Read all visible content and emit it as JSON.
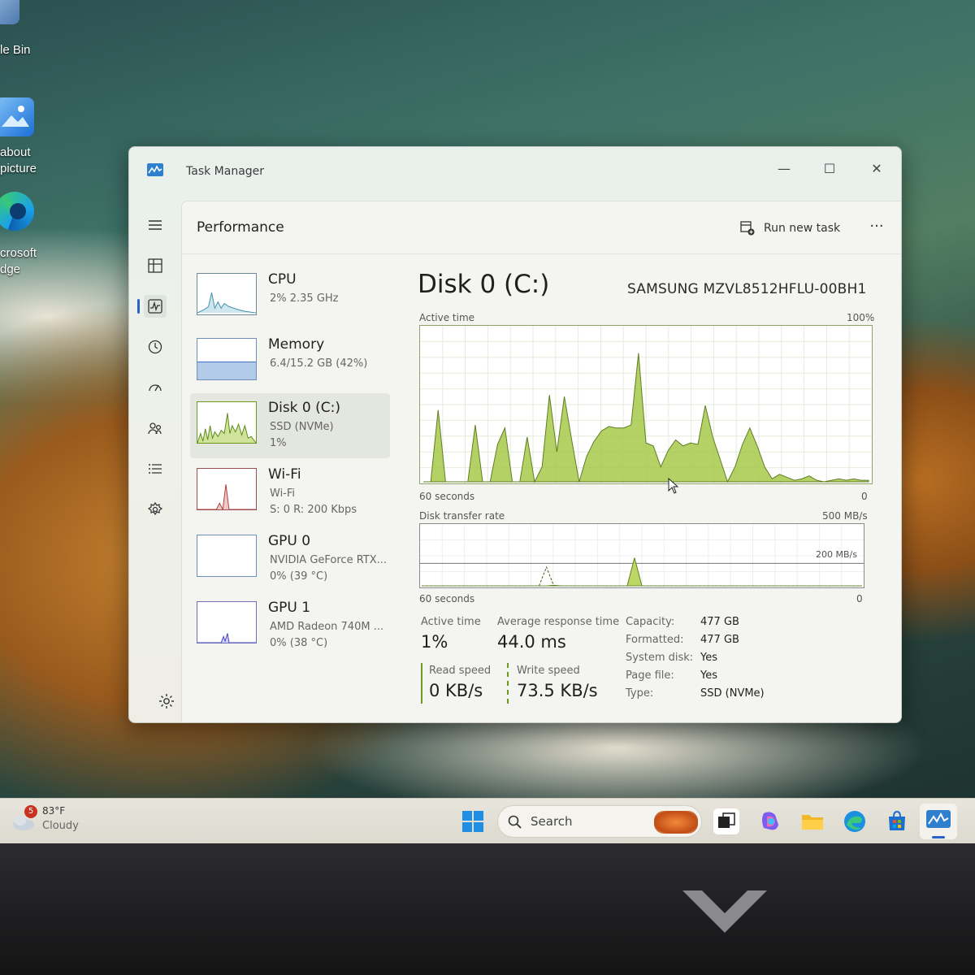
{
  "desktop": {
    "icons": [
      {
        "label_lines": [
          "le Bin"
        ]
      },
      {
        "label_lines": [
          " about",
          "picture"
        ]
      },
      {
        "label_lines": [
          "crosoft",
          "dge"
        ]
      }
    ]
  },
  "window": {
    "title": "Task Manager",
    "minimize_glyph": "—",
    "maximize_glyph": "☐",
    "close_glyph": "✕"
  },
  "header": {
    "page_title": "Performance",
    "run_new_task_label": "Run new task",
    "more_glyph": "···"
  },
  "nav": {
    "items": [
      "hamburger-icon",
      "processes-icon",
      "performance-icon",
      "app-history-icon",
      "startup-apps-icon",
      "users-icon",
      "details-icon",
      "services-icon"
    ],
    "active_index": 2
  },
  "devices": [
    {
      "name": "CPU",
      "sub": "2%  2.35 GHz",
      "sub2": "",
      "color": "#3d8fb0"
    },
    {
      "name": "Memory",
      "sub": "6.4/15.2 GB (42%)",
      "sub2": "",
      "color": "#3f78c8"
    },
    {
      "name": "Disk 0 (C:)",
      "sub": "SSD (NVMe)",
      "sub2": "1%",
      "color": "#6b9a1c"
    },
    {
      "name": "Wi-Fi",
      "sub": "Wi-Fi",
      "sub2": "S: 0  R: 200 Kbps",
      "color": "#b03a3a"
    },
    {
      "name": "GPU 0",
      "sub": "NVIDIA GeForce RTX...",
      "sub2": "0%  (39 °C)",
      "color": "#3f6fb0"
    },
    {
      "name": "GPU 1",
      "sub": "AMD Radeon 740M ...",
      "sub2": "0%  (38 °C)",
      "color": "#4040c8"
    }
  ],
  "disk": {
    "title": "Disk 0 (C:)",
    "model": "SAMSUNG MZVL8512HFLU-00BH1",
    "active_time_label": "Active time",
    "active_time_max": "100%",
    "time_span_label": "60 seconds",
    "zero_label": "0",
    "transfer_label": "Disk transfer rate",
    "transfer_max": "500 MB/s",
    "transfer_mark": "200 MB/s",
    "stats": {
      "active_time_label": "Active time",
      "active_time_value": "1%",
      "avg_response_label": "Average response time",
      "avg_response_value": "44.0 ms",
      "read_speed_label": "Read speed",
      "read_speed_value": "0 KB/s",
      "write_speed_label": "Write speed",
      "write_speed_value": "73.5 KB/s"
    },
    "properties": [
      {
        "key": "Capacity:",
        "value": "477 GB"
      },
      {
        "key": "Formatted:",
        "value": "477 GB"
      },
      {
        "key": "System disk:",
        "value": "Yes"
      },
      {
        "key": "Page file:",
        "value": "Yes"
      },
      {
        "key": "Type:",
        "value": "SSD (NVMe)"
      }
    ]
  },
  "chart_data": [
    {
      "type": "area",
      "title": "Active time",
      "xlabel": "60 seconds",
      "ylim": [
        0,
        100
      ],
      "y_unit": "%",
      "x": [
        0,
        1,
        2,
        3,
        4,
        5,
        6,
        7,
        8,
        9,
        10,
        11,
        12,
        13,
        14,
        15,
        16,
        17,
        18,
        19,
        20,
        21,
        22,
        23,
        24,
        25,
        26,
        27,
        28,
        29,
        30,
        31,
        32,
        33,
        34,
        35,
        36,
        37,
        38,
        39,
        40,
        41,
        42,
        43,
        44,
        45,
        46,
        47,
        48,
        49,
        50,
        51,
        52,
        53,
        54,
        55,
        56,
        57,
        58,
        59,
        60
      ],
      "series": [
        {
          "values": [
            0,
            0,
            48,
            0,
            0,
            0,
            0,
            38,
            0,
            0,
            25,
            36,
            0,
            0,
            30,
            0,
            10,
            58,
            20,
            57,
            28,
            0,
            17,
            27,
            34,
            37,
            36,
            36,
            38,
            86,
            26,
            24,
            10,
            21,
            28,
            24,
            26,
            25,
            51,
            30,
            15,
            0,
            10,
            25,
            36,
            24,
            10,
            2,
            5,
            3,
            1,
            2,
            4,
            1,
            0,
            1,
            2,
            1,
            2,
            1,
            1
          ],
          "color": "#a6c94a"
        }
      ]
    },
    {
      "type": "line",
      "title": "Disk transfer rate",
      "xlabel": "60 seconds",
      "ylim": [
        0,
        500
      ],
      "y_unit": "MB/s",
      "series": [
        {
          "name": "Read speed",
          "style": "dashed",
          "values": [
            0,
            0,
            0,
            0,
            0,
            0,
            0,
            0,
            0,
            0,
            0,
            0,
            0,
            0,
            0,
            0,
            0,
            160,
            0,
            0,
            0,
            0,
            0,
            0,
            0,
            0,
            0,
            0,
            0,
            0,
            0,
            0,
            0,
            0,
            0,
            0,
            0,
            0,
            0,
            0,
            0,
            0,
            0,
            0,
            0,
            0,
            0,
            0,
            0,
            0,
            0,
            0,
            0,
            0,
            0,
            0,
            0,
            0,
            0,
            0,
            0
          ]
        },
        {
          "name": "Write speed",
          "style": "solid",
          "values": [
            0,
            0,
            0,
            0,
            0,
            0,
            0,
            0,
            0,
            0,
            0,
            0,
            0,
            0,
            0,
            0,
            0,
            0,
            5,
            0,
            0,
            0,
            0,
            0,
            0,
            0,
            0,
            0,
            0,
            240,
            0,
            0,
            0,
            0,
            0,
            0,
            0,
            0,
            0,
            0,
            0,
            0,
            0,
            0,
            0,
            0,
            0,
            0,
            0,
            0,
            0,
            0,
            0,
            0,
            0,
            0,
            0,
            0,
            0,
            0,
            0
          ]
        }
      ]
    }
  ],
  "taskbar": {
    "weather_badge": "5",
    "weather_temp": "83°F",
    "weather_desc": "Cloudy",
    "search_label": "Search"
  }
}
